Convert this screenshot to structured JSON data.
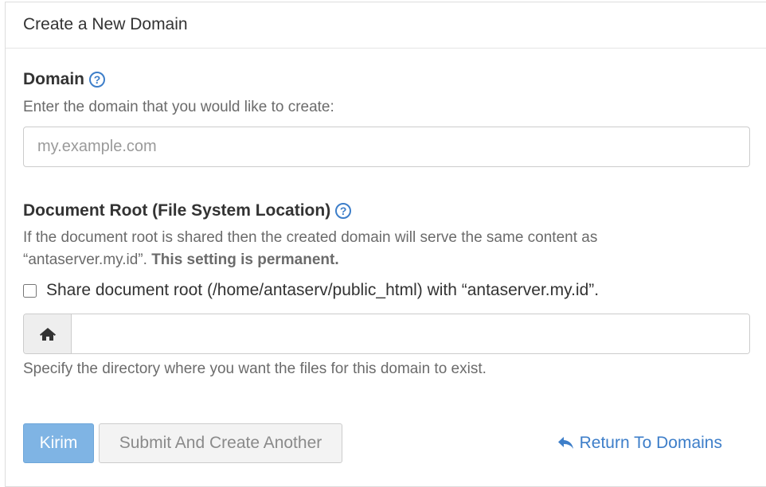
{
  "header": {
    "title": "Create a New Domain"
  },
  "domain_section": {
    "title": "Domain",
    "help_icon": "question-circle-icon",
    "description": "Enter the domain that you would like to create:",
    "input_placeholder": "my.example.com",
    "input_value": ""
  },
  "docroot_section": {
    "title": "Document Root (File System Location)",
    "help_icon": "question-circle-icon",
    "description_prefix": "If the document root is shared then the created domain will serve the same content as",
    "description_domain": "“antaserver.my.id”.",
    "description_bold": "This setting is permanent.",
    "share_checkbox_label": "Share document root (/home/antaserv/public_html) with “antaserver.my.id”.",
    "share_checked": false,
    "addon_icon": "home-icon",
    "path_value": "",
    "hint": "Specify the directory where you want the files for this domain to exist."
  },
  "actions": {
    "submit_label": "Kirim",
    "submit_another_label": "Submit And Create Another",
    "return_label": "Return To Domains",
    "return_icon": "reply-icon"
  },
  "colors": {
    "primary_button": "#7fb4e4",
    "link": "#3d7ec9",
    "muted_text": "#6b6b6b"
  }
}
